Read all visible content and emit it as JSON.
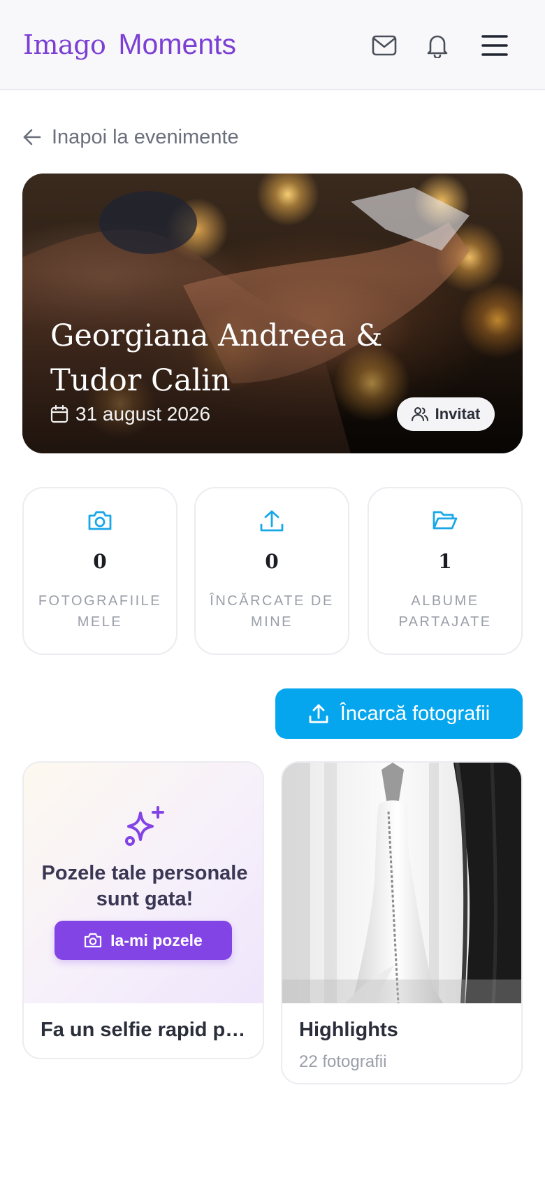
{
  "header": {
    "logo_part1": "Imago",
    "logo_part2": "Moments",
    "icons": [
      "mail-icon",
      "bell-icon",
      "menu-icon"
    ]
  },
  "back_link": {
    "label": "Inapoi la evenimente"
  },
  "event": {
    "title_line1": "Georgiana Andreea &",
    "title_line2": "Tudor Calin",
    "date": "31 august 2026",
    "role_badge": "Invitat"
  },
  "stats": [
    {
      "icon": "camera-icon",
      "value": "0",
      "label": "FOTOGRAFIILE MELE"
    },
    {
      "icon": "upload-icon",
      "value": "0",
      "label": "ÎNCĂRCATE DE MINE"
    },
    {
      "icon": "folder-icon",
      "value": "1",
      "label": "ALBUME PARTAJATE"
    }
  ],
  "upload_button": {
    "label": "Încarcă fotografii"
  },
  "albums": {
    "selfie": {
      "message": "Pozele tale personale sunt gata!",
      "button": "Ia-mi pozele",
      "title": "Fa un selfie rapid pentru pozele tale"
    },
    "highlights": {
      "title": "Highlights",
      "count": "22 fotografii"
    }
  },
  "colors": {
    "brand": "#7b3fd4",
    "primary_button": "#05a6ee",
    "accent_icon": "#1aa7e8",
    "selfie_button": "#8344e6"
  }
}
